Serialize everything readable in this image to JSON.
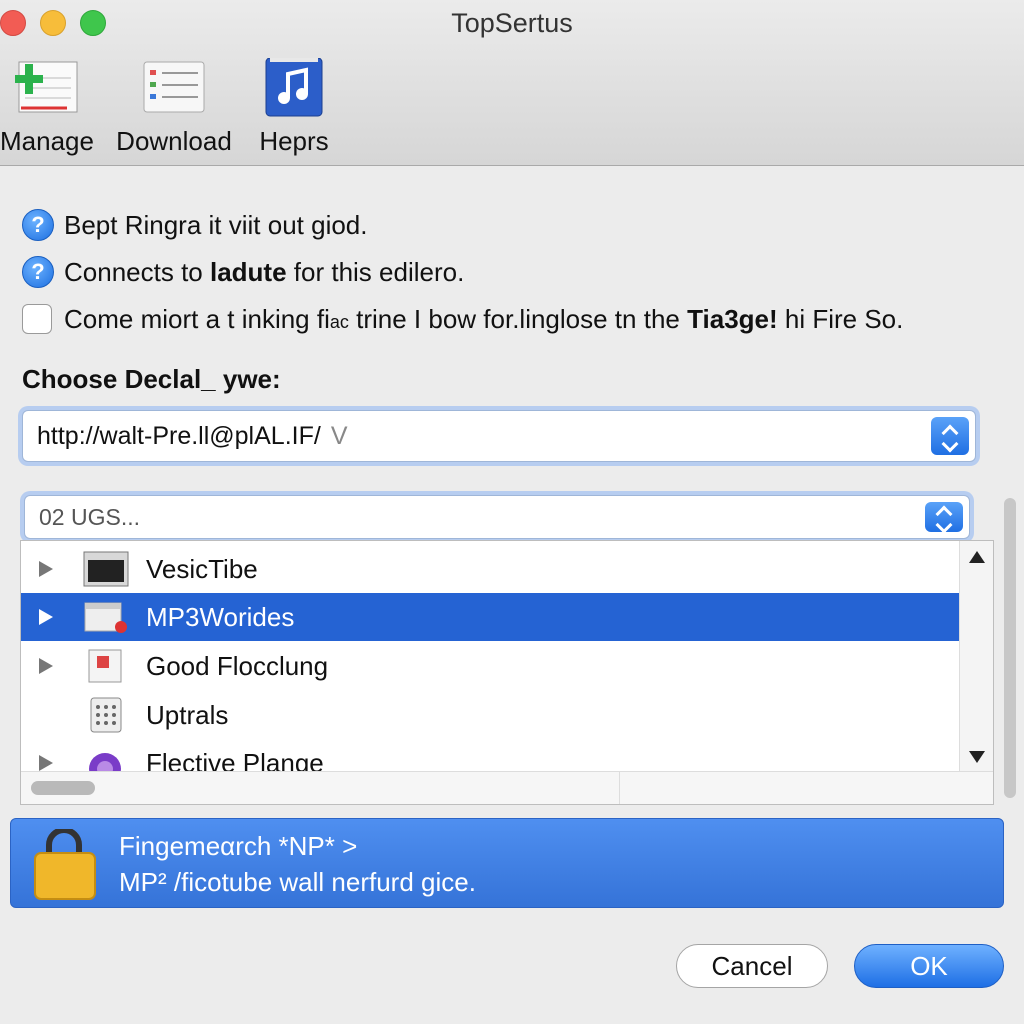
{
  "window": {
    "title": "TopSertus"
  },
  "toolbar": {
    "items": [
      {
        "label": "Manage",
        "icon": "manage-add-icon"
      },
      {
        "label": "Download",
        "icon": "download-list-icon"
      },
      {
        "label": "Heprs",
        "icon": "music-note-icon"
      }
    ]
  },
  "options": {
    "row1": "Bept Ringra it viit out giod.",
    "row2_pre": "Connects to ",
    "row2_bold": "ladute",
    "row2_post": " for this edilero.",
    "row3_pre": "Come miort a t inking fi",
    "row3_small": "ac",
    "row3_mid": " trine I bow for.linglose tn the ",
    "row3_bold": "Tia3ge!",
    "row3_post": " hi Fire So."
  },
  "section": {
    "label": "Choose Declal_ ywe:"
  },
  "url_field": {
    "value": "http://walt-Pre.ll@plAL.IF/",
    "suffix": "V"
  },
  "filter_field": {
    "placeholder": "02 UGS..."
  },
  "list": {
    "items": [
      {
        "label": "VesicTibe",
        "icon": "monitor-icon",
        "expandable": true,
        "selected": false
      },
      {
        "label": "MP3Worides",
        "icon": "window-badge-icon",
        "expandable": true,
        "selected": true
      },
      {
        "label": "Good Flocclung",
        "icon": "document-icon",
        "expandable": true,
        "selected": false
      },
      {
        "label": "Uptrals",
        "icon": "calculator-icon",
        "expandable": false,
        "selected": false
      },
      {
        "label": "Flective Plange",
        "icon": "purple-circle-icon",
        "expandable": true,
        "selected": false
      }
    ]
  },
  "banner": {
    "line1": "Fingemeαrch *NP* >",
    "line2": "MP² /ficotube  wall nerfurd gice."
  },
  "buttons": {
    "cancel": "Cancel",
    "ok": "OK"
  },
  "colors": {
    "accent": "#2563d3",
    "banner": "#3f7fe3"
  }
}
